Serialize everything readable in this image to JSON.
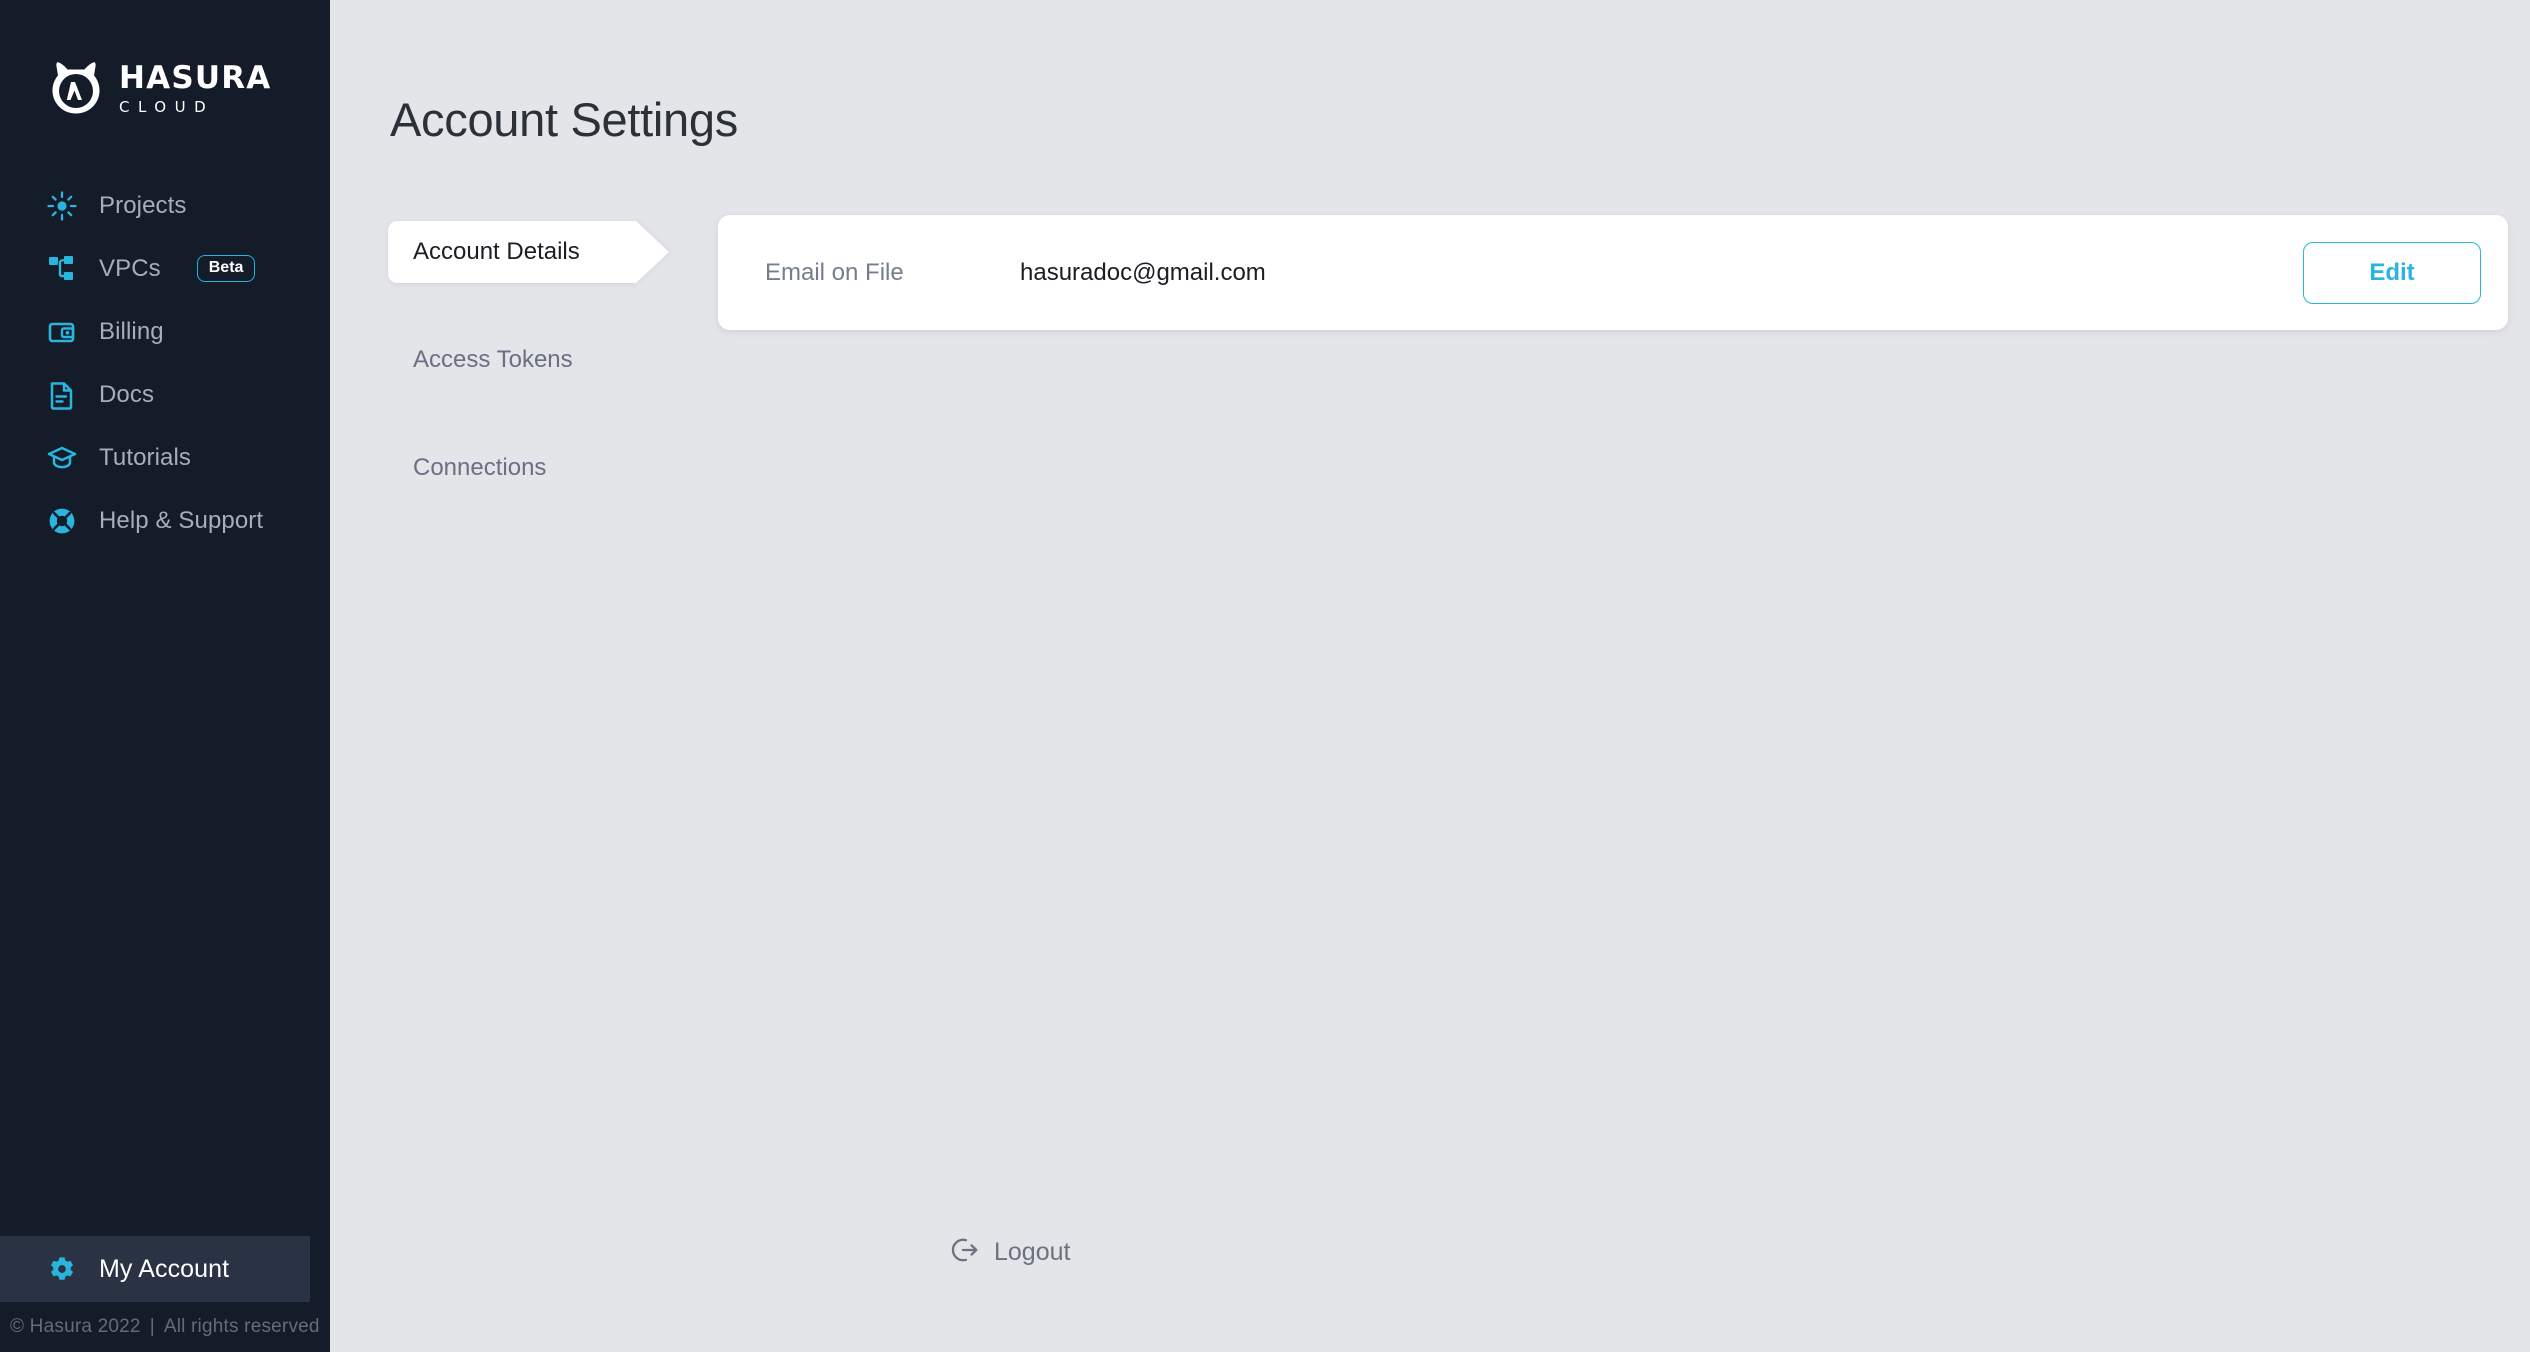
{
  "brand": {
    "name": "HASURA",
    "product": "CLOUD",
    "logo_icon": "hasura-cat-lambda-logo",
    "accent_color": "#29b5dd"
  },
  "sidebar": {
    "background_color": "#141c29",
    "active_item_color": "#2a3344",
    "items": [
      {
        "label": "Projects",
        "icon": "sun-burst-icon",
        "badge": null
      },
      {
        "label": "VPCs",
        "icon": "network-nodes-icon",
        "badge": "Beta"
      },
      {
        "label": "Billing",
        "icon": "wallet-icon",
        "badge": null
      },
      {
        "label": "Docs",
        "icon": "document-icon",
        "badge": null
      },
      {
        "label": "Tutorials",
        "icon": "graduation-cap-icon",
        "badge": null
      },
      {
        "label": "Help & Support",
        "icon": "lifebuoy-icon",
        "badge": null
      }
    ],
    "account_item": {
      "label": "My Account",
      "icon": "gear-icon"
    },
    "footer": {
      "copyright": "© Hasura 2022",
      "separator": "|",
      "rights": "All rights reserved"
    }
  },
  "main": {
    "background_color": "#e4e5e9",
    "page_title": "Account Settings",
    "tabs": [
      {
        "label": "Account Details",
        "active": true
      },
      {
        "label": "Access Tokens",
        "active": false
      },
      {
        "label": "Connections",
        "active": false
      }
    ],
    "account_details": {
      "email_label": "Email on File",
      "email_value": "hasuradoc@gmail.com",
      "edit_button": "Edit"
    },
    "logout": {
      "label": "Logout",
      "icon": "logout-arrow-icon"
    }
  }
}
